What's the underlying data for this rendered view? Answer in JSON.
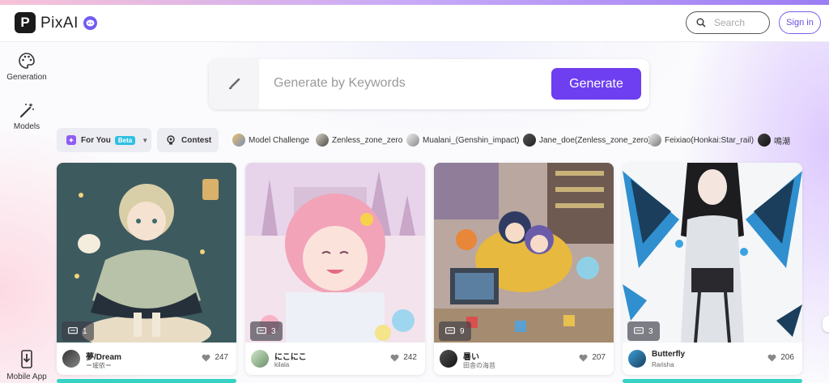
{
  "header": {
    "logo_letter": "P",
    "app_name": "PixAI",
    "search_placeholder": "Search",
    "signin_label": "Sign in"
  },
  "sidebar": {
    "items": [
      {
        "label": "Generation",
        "icon": "palette-icon"
      },
      {
        "label": "Models",
        "icon": "magic-wand-icon"
      },
      {
        "label": "Mobile App",
        "icon": "download-phone-icon"
      }
    ]
  },
  "generate": {
    "placeholder": "Generate by Keywords",
    "button_label": "Generate"
  },
  "tabs": {
    "for_you": "For You",
    "beta": "Beta",
    "contest": "Contest",
    "chips": [
      "Model Challenge",
      "Zenless_zone_zero",
      "Mualani_(Genshin_impact)",
      "Jane_doe(Zenless_zone_zero)",
      "Feixiao(Honkai:Star_rail)",
      "鳴潮"
    ]
  },
  "cards": [
    {
      "comments": "1",
      "user": "夢/Dream",
      "sub": "＝璀依＝",
      "likes": "247"
    },
    {
      "comments": "3",
      "user": "にこにこ",
      "sub": "kilala",
      "likes": "242"
    },
    {
      "comments": "9",
      "user": "暑い",
      "sub": "田舎の海苔",
      "likes": "207"
    },
    {
      "comments": "3",
      "user": "Butterfly",
      "sub": "Rarisha",
      "likes": "206"
    }
  ],
  "colors": {
    "accent": "#6d3ff0",
    "beta_badge": "#2ec0e0",
    "discord": "#6f5cf2"
  }
}
